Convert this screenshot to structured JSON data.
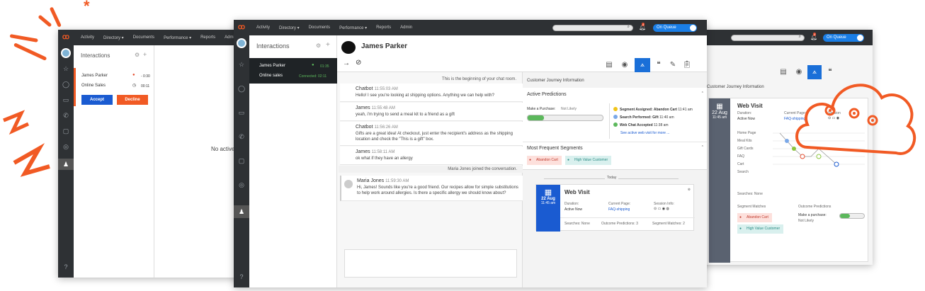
{
  "nav": [
    "Activity",
    "Directory ▾",
    "Documents",
    "Performance ▾",
    "Reports",
    "Admin"
  ],
  "status_toggle": "On Queue",
  "notification_count": "4",
  "left_window": {
    "panel_title": "Interactions",
    "item1_name": "James Parker",
    "item1_time": "- 0:30",
    "item2_name": "Online Sales",
    "item2_time": "00:11",
    "accept": "Accept",
    "decline": "Decline",
    "empty_text": "No active"
  },
  "main_window": {
    "panel_title": "Interactions",
    "active_name": "James Parker",
    "active_time": "01:35",
    "active_queue": "Online sales",
    "active_status": "Connected: 02:11",
    "header_name": "James Parker",
    "chat_start": "This is the beginning of your chat room.",
    "messages": [
      {
        "who": "Chatbot",
        "time": "11:55:03 AM",
        "text": "Hello! I see you're looking at shipping options. Anything we can help with?"
      },
      {
        "who": "James",
        "time": "11:55:48 AM",
        "text": "yeah, i'm trying to send a meal kit to a friend as a gift"
      },
      {
        "who": "Chatbot",
        "time": "11:56:26 AM",
        "text": "Gifts are a great idea! At checkout, just enter the recipient's address as the shipping location and check the \"This is a gift\" box."
      },
      {
        "who": "James",
        "time": "11:58:11 AM",
        "text": "ok what if they have an allergy"
      }
    ],
    "joined": "Maria Jones joined the conversation.",
    "agent_msg": {
      "who": "Maria Jones",
      "time": "11:59:30 AM",
      "text": "Hi, James! Sounds like you're a good friend. Our recipes allow for simple substitutions to help work around allergies. Is there a specific allergy we should know about?"
    },
    "cj_title": "Customer Journey Information",
    "active_predictions": "Active Predictions",
    "make_purchase": "Make a Purchase:",
    "not_likely": "Not Likely",
    "events": [
      {
        "label": "Segment Assigned:",
        "value": "Abandon Cart",
        "time": "11:41 am",
        "color": "#f0c419"
      },
      {
        "label": "Search Performed:",
        "value": "Gift",
        "time": "11:40 am",
        "color": "#7aa8e8"
      },
      {
        "label": "Web Chat Accepted",
        "value": "",
        "time": "11:38 am",
        "color": "#5cb85c"
      }
    ],
    "see_more": "See active web visit for more ...",
    "frequent_segments": "Most Frequent Segments",
    "seg1": "Abandon Cart",
    "seg2": "High Value Customer",
    "today": "Today",
    "wv_title": "Web Visit",
    "wv_date": "22 Aug",
    "wv_time": "11:45 am",
    "duration_label": "Duration:",
    "duration_value": "Active Now",
    "page_label": "Current Page:",
    "page_value": "FAQ-shipping",
    "session_label": "Session Info:",
    "searches": "Searches: None",
    "outcome_predictions": "Outcome Predictions: 3",
    "segment_matches": "Segment Matches: 2"
  },
  "right_window": {
    "cj_title": "Customer Journey Information",
    "wv_title": "Web Visit",
    "wv_date": "22 Aug",
    "wv_time": "11:45 am",
    "duration_label": "Duration:",
    "duration_value": "Active Now",
    "page_label": "Current Page:",
    "page_value": "FAQ-shipping",
    "session_label": "Session",
    "journey_pages": [
      "Home Page",
      "Meal Kits",
      "Gift Cards",
      "FAQ",
      "Cart",
      "Search"
    ],
    "searches": "Searches: None",
    "segment_matches": "Segment Matches",
    "outcome_predictions": "Outcome Predictions",
    "seg1": "Abandon Cart",
    "seg2": "High Value Customer",
    "make_purchase": "Make a purchase:",
    "not_likely": "Not Likely"
  }
}
